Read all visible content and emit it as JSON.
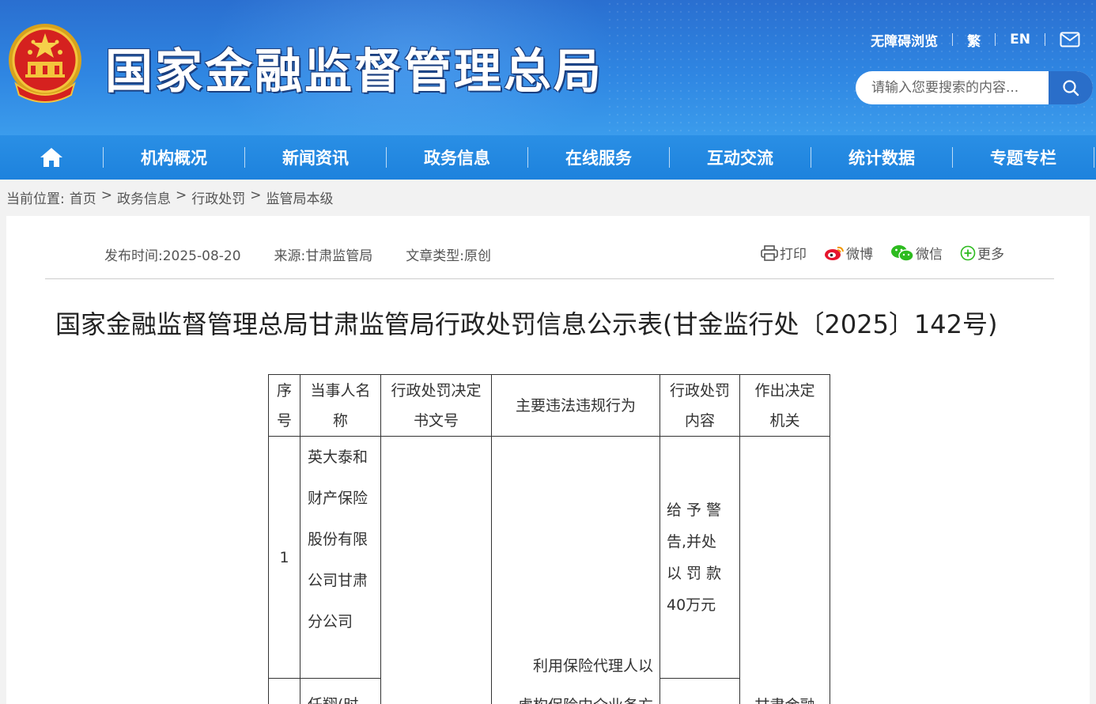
{
  "header": {
    "site_title": "国家金融监督管理总局",
    "top_links": [
      "无障碍浏览",
      "繁",
      "EN"
    ],
    "mail_icon": "mail-icon",
    "search_placeholder": "请输入您要搜索的内容...",
    "colors": {
      "header_blue": "#2f86e2",
      "nav_blue": "#1d82dd",
      "search_button": "#2a6ec9"
    }
  },
  "nav": {
    "home_icon": "home-icon",
    "items": [
      "机构概况",
      "新闻资讯",
      "政务信息",
      "在线服务",
      "互动交流",
      "统计数据",
      "专题专栏"
    ]
  },
  "breadcrumb": {
    "label": "当前位置:",
    "items": [
      "首页",
      "政务信息",
      "行政处罚",
      "监管局本级"
    ],
    "separator": ">"
  },
  "article": {
    "publish_time": "发布时间:2025-08-20",
    "source": "来源:甘肃监管局",
    "type": "文章类型:原创",
    "share": [
      "打印",
      "微博",
      "微信",
      "更多"
    ],
    "title": "国家金融监督管理总局甘肃监管局行政处罚信息公示表(甘金监行处〔2025〕142号)"
  },
  "table": {
    "headers": {
      "seq_1": "序",
      "seq_2": "号",
      "party_1": "当事人名",
      "party_2": "称",
      "doc_1": "行政处罚决定",
      "doc_2": "书文号",
      "act": "主要违法违规行为",
      "content_1": "行政处罚",
      "content_2": "内容",
      "org_1": "作出决定",
      "org_2": "机关"
    },
    "rows": [
      {
        "seq": "1",
        "party": [
          "英大泰和",
          "财产保险",
          "股份有限",
          "公司甘肃",
          "分公司"
        ],
        "content": [
          "给 予 警",
          "告,并处",
          "以 罚 款",
          "40万元"
        ]
      },
      {
        "party_partial": "任翔(时"
      }
    ],
    "act_partial": [
      "利用保险代理人以",
      "虚构保险中介业务方"
    ],
    "org_partial": "甘肃金融"
  }
}
